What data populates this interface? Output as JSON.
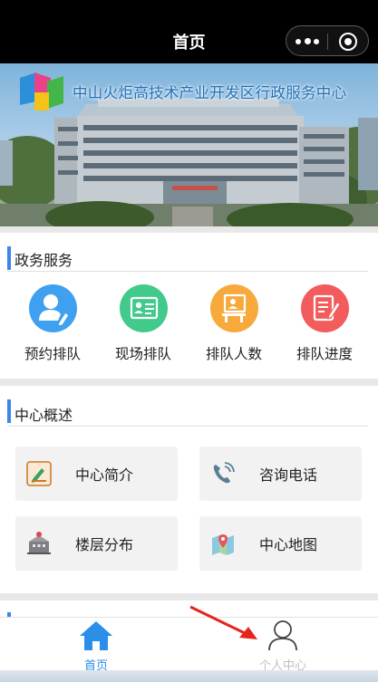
{
  "header": {
    "title": "首页"
  },
  "banner": {
    "text": "中山火炬高技术产业开发区行政服务中心"
  },
  "services": {
    "heading": "政务服务",
    "items": [
      {
        "label": "预约排队",
        "icon": "user-edit-icon",
        "color": "#3fa0f0"
      },
      {
        "label": "现场排队",
        "icon": "id-card-icon",
        "color": "#42c98c"
      },
      {
        "label": "排队人数",
        "icon": "presenter-icon",
        "color": "#f8a93b"
      },
      {
        "label": "排队进度",
        "icon": "notepad-pen-icon",
        "color": "#f25c5c"
      }
    ]
  },
  "overview": {
    "heading": "中心概述",
    "items": [
      {
        "label": "中心简介",
        "icon": "document-pen-icon"
      },
      {
        "label": "咨询电话",
        "icon": "phone-icon"
      },
      {
        "label": "楼层分布",
        "icon": "building-icon"
      },
      {
        "label": "中心地图",
        "icon": "map-icon"
      }
    ]
  },
  "tabbar": {
    "items": [
      {
        "label": "首页",
        "icon": "home-icon",
        "active": true,
        "color": "#2b8ee8"
      },
      {
        "label": "个人中心",
        "icon": "person-icon",
        "active": false,
        "color": "#c0c0c0"
      }
    ]
  }
}
